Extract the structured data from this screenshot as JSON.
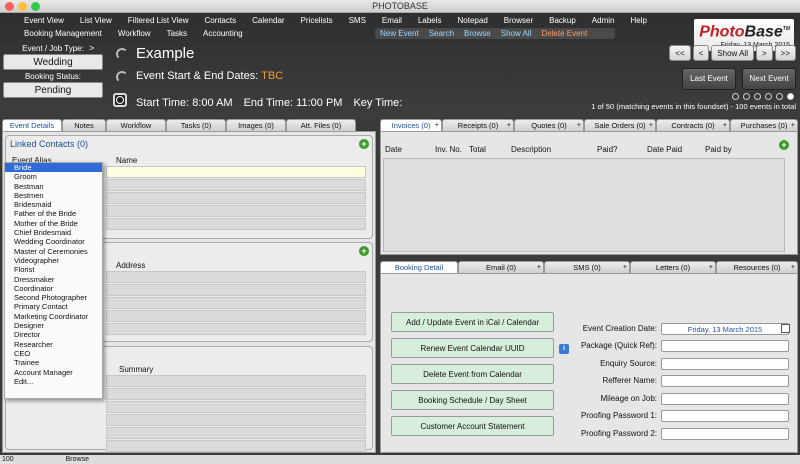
{
  "window": {
    "title": "PHOTOBASE"
  },
  "menu": {
    "row1": [
      "Event View",
      "List View",
      "Filtered List View",
      "Contacts",
      "Calendar",
      "Pricelists",
      "SMS",
      "Email",
      "Labels",
      "Notepad",
      "Browser",
      "Backup",
      "Admin",
      "Help"
    ],
    "row2": [
      "Booking Management",
      "Workflow",
      "Tasks",
      "Accounting"
    ],
    "row3": [
      "New Event",
      "Search",
      "Browse",
      "Show All",
      "Delete Event"
    ]
  },
  "logo": {
    "brand_a": "Photo",
    "brand_b": "Base",
    "tm": "TM",
    "date": "Friday, 13 March 2015"
  },
  "left": {
    "type_label": "Event / Job Type:",
    "type_value": "Wedding",
    "status_label": "Booking Status:",
    "status_value": "Pending",
    "chev": ">"
  },
  "event": {
    "name": "Example",
    "dates_label": "Event Start & End Dates:",
    "dates_value": "TBC",
    "start_time": "Start Time: 8:00 AM",
    "end_time": "End Time: 11:00 PM",
    "key_time": "Key Time:"
  },
  "nav": {
    "first": "<<",
    "prev": "<",
    "show_all": "Show All",
    "next": ">",
    "last": ">>",
    "last_event": "Last Event",
    "next_event": "Next Event",
    "count": "1 of 50 (matching events in this foundset) - 100 events in total"
  },
  "left_tabs": [
    "Event Details",
    "Notes",
    "Workflow",
    "Tasks (0)",
    "Images (0)",
    "Att. Files (0)"
  ],
  "contacts": {
    "title": "Linked Contacts (0)",
    "col_alias": "Event Alias",
    "col_name": "Name"
  },
  "venues": {
    "col_address": "Address"
  },
  "summary": {
    "col": "Summary"
  },
  "alias_options": [
    "Bride",
    "Groom",
    "Bestman",
    "Bestmen",
    "Bridesmaid",
    "Father of the Bride",
    "Mother of the Bride",
    "Chief Bridesmaid",
    "Wedding Coordinator",
    "Master of Ceremonies",
    "Videographer",
    "Florist",
    "Dressmaker",
    "Coordinator",
    "Second Photographer",
    "Primary Contact",
    "Marketing Coordinator",
    "Designer",
    "Director",
    "Researcher",
    "CEO",
    "Trainee",
    "Account Manager",
    "Edit..."
  ],
  "right_tabs": [
    "Invoices (0)",
    "Receipts (0)",
    "Quotes (0)",
    "Sale Orders (0)",
    "Contracts (0)",
    "Purchases (0)"
  ],
  "invoice_cols": [
    "Date",
    "Inv. No.",
    "Total",
    "Description",
    "Paid?",
    "Date Paid",
    "Paid by"
  ],
  "booking_tabs": [
    "Booking Detail",
    "Email (0)",
    "SMS (0)",
    "Letters (0)",
    "Resources (0)"
  ],
  "booking_buttons": [
    "Add / Update Event in iCal / Calendar",
    "Renew Event Calendar UUID",
    "Delete Event from Calendar",
    "Booking Schedule / Day Sheet",
    "Customer Account Statement"
  ],
  "booking_fields": {
    "creation_label": "Event Creation Date:",
    "creation_value": "Friday, 13 March 2015",
    "labels": [
      "Package (Quick Ref):",
      "Enquiry Source:",
      "Refferer Name:",
      "Mileage on Job:",
      "Proofing Password 1:",
      "Proofing Password 2:"
    ]
  },
  "statusbar": {
    "zoom": "100",
    "mode": "Browse"
  },
  "colors": {
    "accent_orange": "#f39a2b",
    "link_blue": "#9bd7ff",
    "delete_orange": "#ff9c6a",
    "add_green": "#3a9a2a"
  }
}
